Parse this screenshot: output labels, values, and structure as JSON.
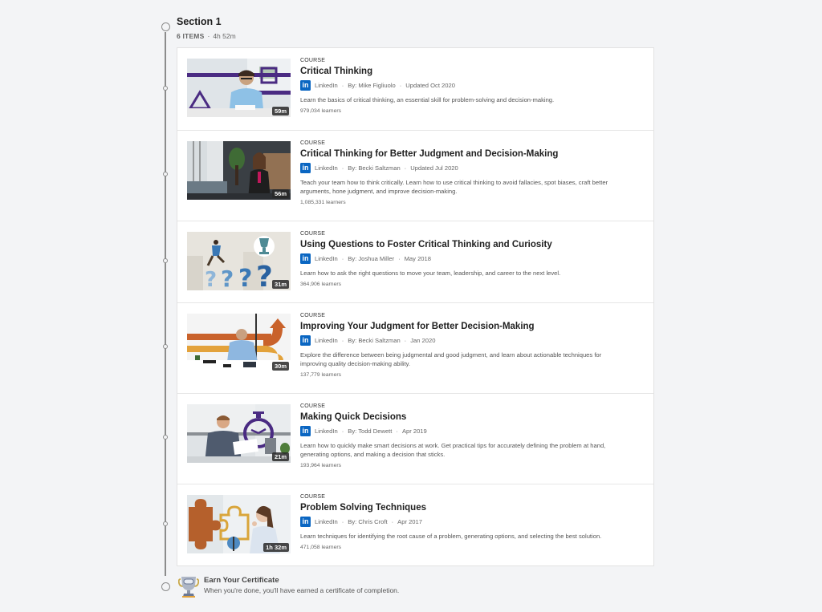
{
  "section": {
    "title": "Section 1",
    "items_count": "6 ITEMS",
    "duration": "4h 52m"
  },
  "courses": [
    {
      "type": "COURSE",
      "title": "Critical Thinking",
      "provider": "LinkedIn",
      "author": "By: Mike Figliuolo",
      "date": "Updated Oct 2020",
      "description": "Learn the basics of critical thinking, an essential skill for problem-solving and decision-making.",
      "learners": "979,034 learners",
      "duration": "59m",
      "thumbnail": "man-writing-purple-shapes"
    },
    {
      "type": "COURSE",
      "title": "Critical Thinking for Better Judgment and Decision-Making",
      "provider": "LinkedIn",
      "author": "By: Becki Saltzman",
      "date": "Updated Jul 2020",
      "description": "Teach your team how to think critically. Learn how to use critical thinking to avoid fallacies, spot biases, craft better arguments, hone judgment, and improve decision-making.",
      "learners": "1,085,331 learners",
      "duration": "56m",
      "thumbnail": "woman-speaking-office"
    },
    {
      "type": "COURSE",
      "title": "Using Questions to Foster Critical Thinking and Curiosity",
      "provider": "LinkedIn",
      "author": "By: Joshua Miller",
      "date": "May 2018",
      "description": "Learn how to ask the right questions to move your team, leadership, and career to the next level.",
      "learners": "364,906 learners",
      "duration": "31m",
      "thumbnail": "question-marks-trophy"
    },
    {
      "type": "COURSE",
      "title": "Improving Your Judgment for Better Decision-Making",
      "provider": "LinkedIn",
      "author": "By: Becki Saltzman",
      "date": "Jan 2020",
      "description": "Explore the difference between being judgmental and good judgment, and learn about actionable techniques for improving quality decision-making ability.",
      "learners": "137,779 learners",
      "duration": "30m",
      "thumbnail": "man-desk-arrows"
    },
    {
      "type": "COURSE",
      "title": "Making Quick Decisions",
      "provider": "LinkedIn",
      "author": "By: Todd Dewett",
      "date": "Apr 2019",
      "description": "Learn how to quickly make smart decisions at work. Get practical tips for accurately defining the problem at hand, generating options, and making a decision that sticks.",
      "learners": "193,964 learners",
      "duration": "21m",
      "thumbnail": "man-stopwatch"
    },
    {
      "type": "COURSE",
      "title": "Problem Solving Techniques",
      "provider": "LinkedIn",
      "author": "By: Chris Croft",
      "date": "Apr 2017",
      "description": "Learn techniques for identifying the root cause of a problem, generating options, and selecting the best solution.",
      "learners": "471,058 learners",
      "duration": "1h 32m",
      "thumbnail": "woman-puzzle-pieces"
    }
  ],
  "certificate": {
    "title": "Earn Your Certificate",
    "description": "When you're done, you'll have earned a certificate of completion."
  },
  "colors": {
    "linkedin_blue": "#0a66c2",
    "background": "#f3f4f6"
  }
}
